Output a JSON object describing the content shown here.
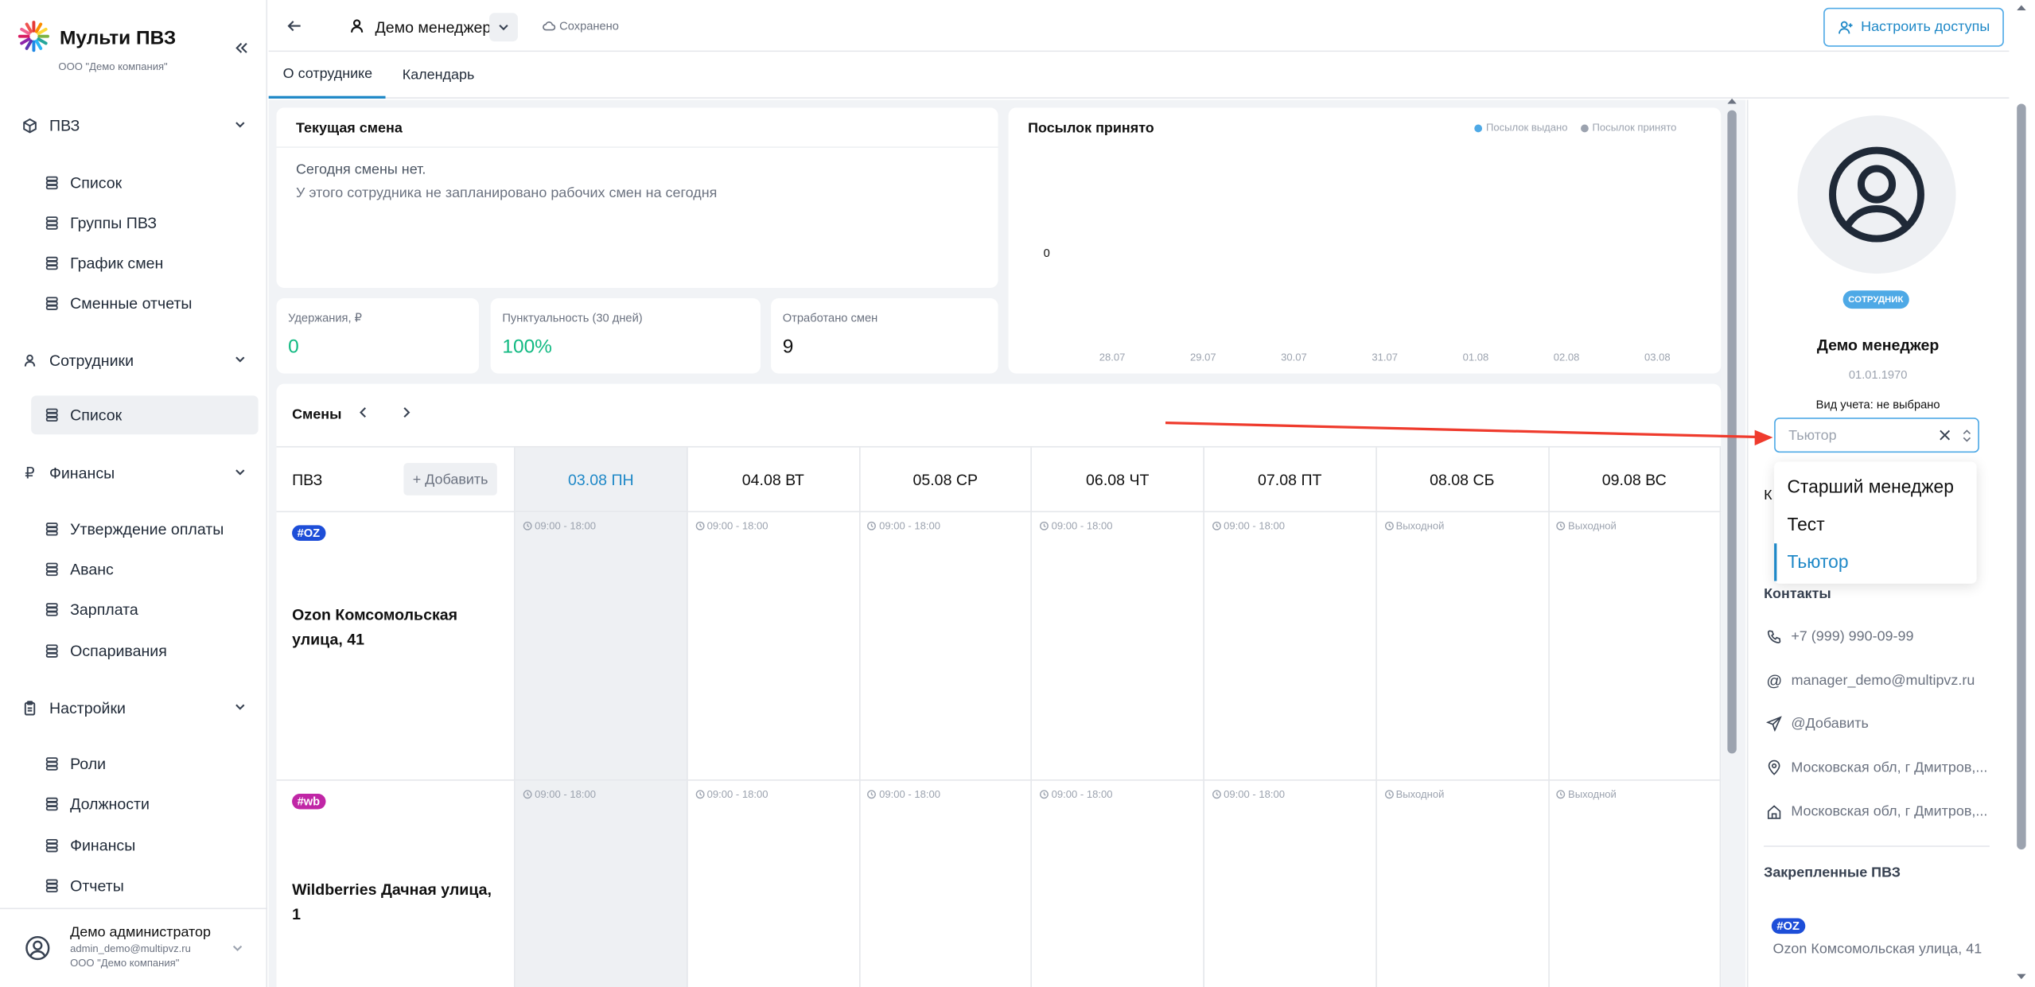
{
  "sidebar": {
    "app_name": "Мульти ПВЗ",
    "company": "ООО \"Демо компания\"",
    "sections": [
      {
        "label": "ПВЗ",
        "items": [
          {
            "label": "Список"
          },
          {
            "label": "Группы ПВЗ"
          },
          {
            "label": "График смен"
          },
          {
            "label": "Сменные отчеты"
          }
        ]
      },
      {
        "label": "Сотрудники",
        "items": [
          {
            "label": "Список"
          }
        ]
      },
      {
        "label": "Финансы",
        "items": [
          {
            "label": "Утверждение оплаты"
          },
          {
            "label": "Аванс"
          },
          {
            "label": "Зарплата"
          },
          {
            "label": "Оспаривания"
          }
        ]
      },
      {
        "label": "Настройки",
        "items": [
          {
            "label": "Роли"
          },
          {
            "label": "Должности"
          },
          {
            "label": "Финансы"
          },
          {
            "label": "Отчеты"
          }
        ]
      }
    ],
    "user": {
      "name": "Демо администратор",
      "email": "admin_demo@multipvz.ru",
      "company": "ООО \"Демо компания\""
    }
  },
  "header": {
    "title": "Демо менеджер",
    "saved": "Сохранено",
    "access_button": "Настроить доступы"
  },
  "tabs": [
    {
      "label": "О сотруднике"
    },
    {
      "label": "Календарь"
    }
  ],
  "current_shift": {
    "title": "Текущая смена",
    "headline": "Сегодня смены нет.",
    "text": "У этого сотрудника не запланировано рабочих смен на сегодня"
  },
  "stats": [
    {
      "label": "Удержания, ₽",
      "value": "0"
    },
    {
      "label": "Пунктуальность (30 дней)",
      "value": "100%"
    },
    {
      "label": "Отработано смен",
      "value": "9"
    }
  ],
  "chart": {
    "title": "Посылок принято",
    "legend": [
      "Посылок выдано",
      "Посылок принято"
    ],
    "colors": {
      "issued": "#4ea9e6",
      "accepted": "#9ca3af"
    }
  },
  "chart_data": {
    "type": "line",
    "title": "Посылок принято",
    "categories": [
      "28.07",
      "29.07",
      "30.07",
      "31.07",
      "01.08",
      "02.08",
      "03.08"
    ],
    "y_ticks": [
      "0"
    ],
    "series": [
      {
        "name": "Посылок выдано",
        "values": [
          0,
          0,
          0,
          0,
          0,
          0,
          0
        ]
      },
      {
        "name": "Посылок принято",
        "values": [
          0,
          0,
          0,
          0,
          0,
          0,
          0
        ]
      }
    ],
    "legend_position": "top-right"
  },
  "schedule": {
    "title": "Смены",
    "pvz_header": "ПВЗ",
    "add_button": "+ Добавить",
    "days": [
      "03.08 ПН",
      "04.08 ВТ",
      "05.08 СР",
      "06.08 ЧТ",
      "07.08 ПТ",
      "08.08 СБ",
      "09.08 ВС"
    ],
    "rows": [
      {
        "tag": "#OZ",
        "tag_color": "#1d4ed8",
        "name": "Ozon Комсомольская улица, 41",
        "cells": [
          "09:00 - 18:00",
          "09:00 - 18:00",
          "09:00 - 18:00",
          "09:00 - 18:00",
          "09:00 - 18:00",
          "Выходной",
          "Выходной"
        ]
      },
      {
        "tag": "#wb",
        "tag_color": "#c026a6",
        "name": "Wildberries Дачная улица, 1",
        "cells": [
          "09:00 - 18:00",
          "09:00 - 18:00",
          "09:00 - 18:00",
          "09:00 - 18:00",
          "09:00 - 18:00",
          "Выходной",
          "Выходной"
        ]
      }
    ]
  },
  "profile": {
    "role_badge": "СОТРУДНИК",
    "name": "Демо менеджер",
    "birthdate": "01.01.1970",
    "account_type": "Вид учета: не выбрано",
    "position_value": "Тьютор",
    "dropdown_options": [
      "Старший менеджер",
      "Тест",
      "Тьютор"
    ],
    "contacts_title": "Контакты",
    "contacts": [
      "+7 (999) 990-09-99",
      "manager_demo@multipvz.ru",
      "@Добавить",
      "Московская обл, г Дмитров,...",
      "Московская обл, г Дмитров,..."
    ],
    "pinned_title": "Закрепленные ПВЗ",
    "pinned": [
      {
        "tag": "#OZ",
        "name": "Ozon Комсомольская улица, 41"
      }
    ]
  }
}
